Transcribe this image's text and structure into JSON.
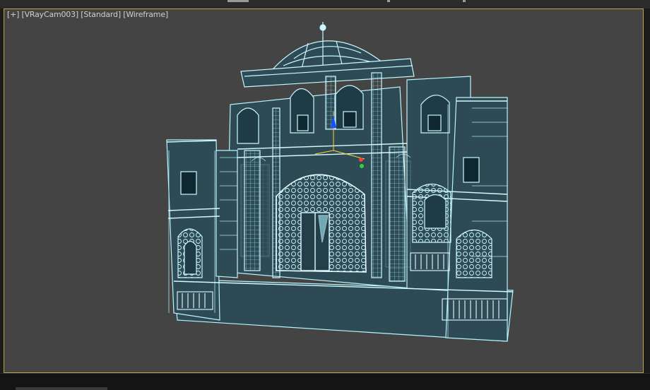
{
  "viewport": {
    "label": {
      "plus": "[+]",
      "camera": "[VRayCam003]",
      "shading": "[Standard]",
      "mode": "[Wireframe]"
    },
    "background_color": "#444444",
    "wire_color": "#b8f6ff",
    "border_color": "#b5a448"
  },
  "scene": {
    "object": "palace-facade-wireframe",
    "gizmo": {
      "axes": [
        "x",
        "y",
        "z"
      ]
    }
  }
}
